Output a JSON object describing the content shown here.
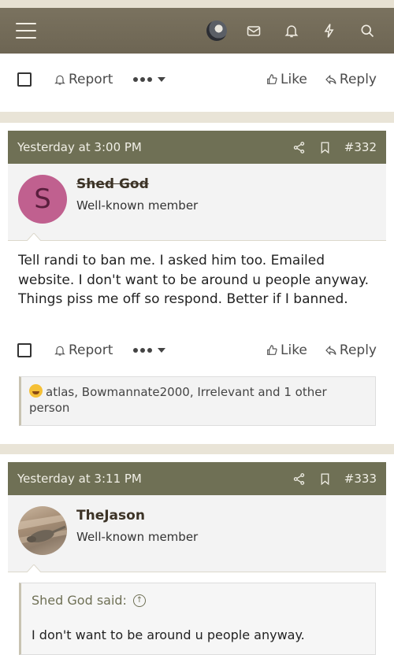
{
  "actions": {
    "report": "Report",
    "like": "Like",
    "reply": "Reply"
  },
  "posts": [
    {
      "timestamp": "Yesterday at 3:00 PM",
      "number": "#332",
      "author": "Shed God",
      "author_initial": "S",
      "author_title": "Well-known member",
      "body": "Tell randi to ban me. I asked him too. Emailed website. I don't want to be around u people anyway. Things piss me off so respond. Better if I banned.",
      "reactions": "atlas, Bowmannate2000, Irrelevant and 1 other person"
    },
    {
      "timestamp": "Yesterday at 3:11 PM",
      "number": "#333",
      "author": "TheJason",
      "author_title": "Well-known member",
      "quote_author": "Shed God said:",
      "quote_text": "I don't want to be around u people anyway."
    }
  ],
  "colors": {
    "navbar": "#6d6553",
    "post_header": "#6f7055",
    "avatar_s": "#c0608f"
  },
  "icons": [
    "menu-icon",
    "mail-icon",
    "bell-icon",
    "lightning-icon",
    "search-icon",
    "share-icon",
    "bookmark-icon",
    "bell-report-icon",
    "thumbs-up-icon",
    "reply-icon",
    "laughing-emoji-icon"
  ]
}
